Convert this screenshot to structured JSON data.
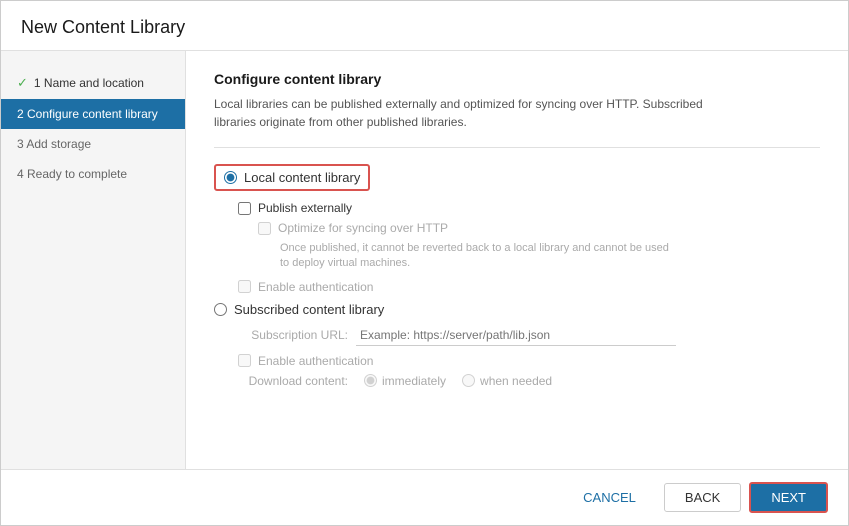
{
  "dialog": {
    "title": "New Content Library"
  },
  "sidebar": {
    "items": [
      {
        "id": "step1",
        "label": "1 Name and location",
        "state": "completed"
      },
      {
        "id": "step2",
        "label": "2 Configure content library",
        "state": "active"
      },
      {
        "id": "step3",
        "label": "3 Add storage",
        "state": "default"
      },
      {
        "id": "step4",
        "label": "4 Ready to complete",
        "state": "default"
      }
    ]
  },
  "main": {
    "section_title": "Configure content library",
    "description_line1": "Local libraries can be published externally and optimized for syncing over HTTP. Subscribed",
    "description_line2": "libraries originate from other published libraries.",
    "local_radio_label": "Local content library",
    "publish_externally_label": "Publish externally",
    "optimize_label": "Optimize for syncing over HTTP",
    "once_published_desc": "Once published, it cannot be reverted back to a local library and cannot be used",
    "to_deploy_desc": "to deploy virtual machines.",
    "enable_auth_local_label": "Enable authentication",
    "subscribed_radio_label": "Subscribed content library",
    "subscription_url_label": "Subscription URL:",
    "subscription_url_placeholder": "Example: https://server/path/lib.json",
    "enable_auth_sub_label": "Enable authentication",
    "download_content_label": "Download content:",
    "immediately_label": "immediately",
    "when_needed_label": "when needed"
  },
  "footer": {
    "cancel_label": "CANCEL",
    "back_label": "BACK",
    "next_label": "NEXT"
  }
}
